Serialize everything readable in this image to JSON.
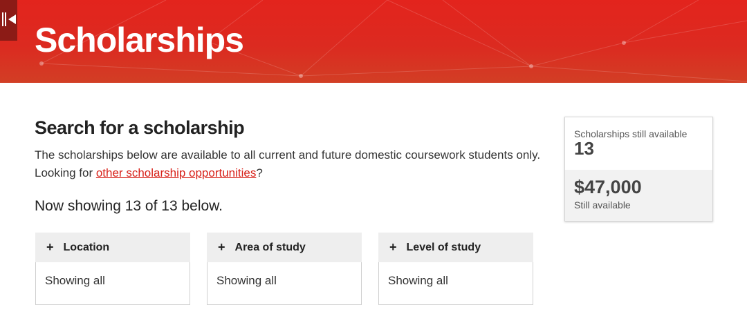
{
  "hero": {
    "title": "Scholarships",
    "brand_color": "#e3241d"
  },
  "sidebar_toggle": {
    "icon": "collapse-sidebar-icon"
  },
  "search": {
    "heading": "Search for a scholarship",
    "description": "The scholarships below are available to all current and future domestic coursework students only.",
    "looking_prefix": "Looking for ",
    "link_text": "other scholarship opportunities",
    "looking_suffix": "?",
    "showing_text": "Now showing 13 of 13 below."
  },
  "filters": [
    {
      "icon": "plus-icon",
      "plus": "+",
      "label": "Location",
      "value": "Showing all"
    },
    {
      "icon": "plus-icon",
      "plus": "+",
      "label": "Area of study",
      "value": "Showing all"
    },
    {
      "icon": "plus-icon",
      "plus": "+",
      "label": "Level of study",
      "value": "Showing all"
    }
  ],
  "stats": {
    "available_label": "Scholarships still available",
    "available_count": "13",
    "amount": "$47,000",
    "amount_label": "Still available"
  }
}
